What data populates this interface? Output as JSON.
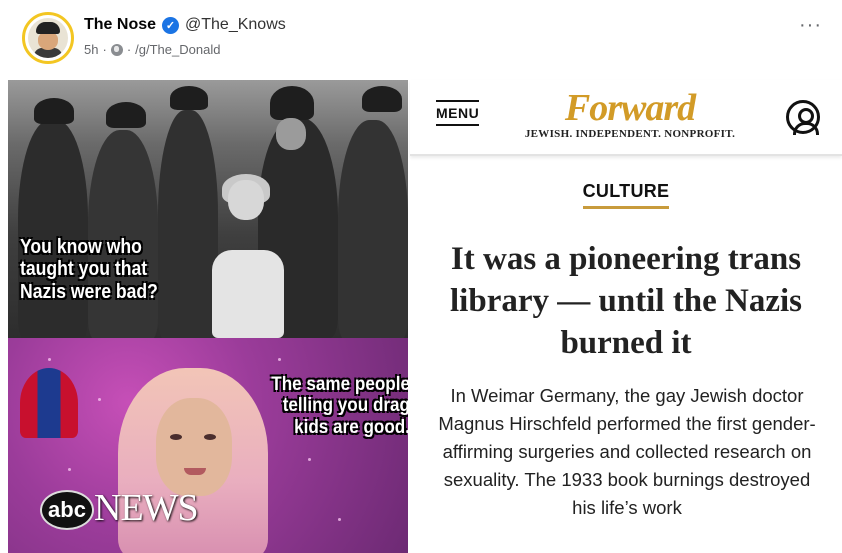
{
  "post": {
    "author_name": "The Nose",
    "handle": "@The_Knows",
    "time": "5h",
    "group": "/g/The_Donald",
    "more_label": "···",
    "verified_icon": "verified-badge-icon"
  },
  "meme": {
    "top_caption": "You know who taught you that Nazis were bad?",
    "bottom_caption": "The same people telling you drag kids are good.",
    "abc_logo": "abc",
    "news_word": "NEWS"
  },
  "article": {
    "menu_label": "MENU",
    "logo": "Forward",
    "tagline": "JEWISH. INDEPENDENT. NONPROFIT.",
    "section": "CULTURE",
    "headline": "It was a pioneering trans library — until the Nazis burned it",
    "dek": "In Weimar Germany, the gay Jewish doctor Magnus Hirschfeld performed the first gender-affirming surgeries and collected research on sexuality. The 1933 book burnings destroyed his life’s work",
    "logo_color": "#d29b27",
    "accent_color": "#c89b3c"
  }
}
